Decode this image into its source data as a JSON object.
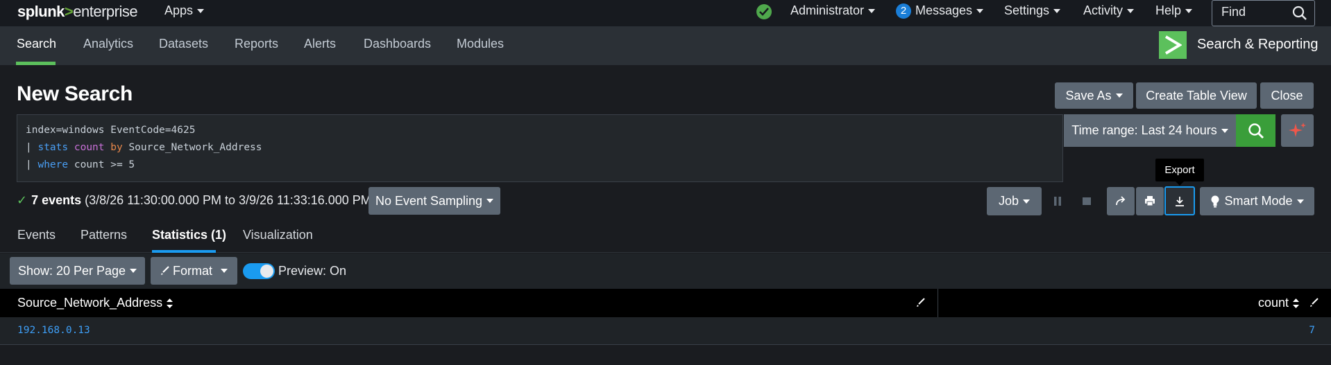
{
  "topbar": {
    "logo_bold": "splunk",
    "logo_gt": ">",
    "logo_rest": "enterprise",
    "apps_label": "Apps",
    "admin_label": "Administrator",
    "messages_count": "2",
    "messages_label": "Messages",
    "settings_label": "Settings",
    "activity_label": "Activity",
    "help_label": "Help",
    "find_label": "Find"
  },
  "appbar": {
    "tabs": [
      {
        "label": "Search"
      },
      {
        "label": "Analytics"
      },
      {
        "label": "Datasets"
      },
      {
        "label": "Reports"
      },
      {
        "label": "Alerts"
      },
      {
        "label": "Dashboards"
      },
      {
        "label": "Modules"
      }
    ],
    "app_name": "Search & Reporting"
  },
  "search": {
    "title": "New Search",
    "save_as": "Save As",
    "create_table_view": "Create Table View",
    "close": "Close",
    "query": {
      "line1": "index=windows EventCode=4625",
      "line2_pipe": "| ",
      "line2_cmd": "stats",
      "line2_func": "count",
      "line2_by": "by",
      "line2_field": "Source_Network_Address",
      "line3_pipe": "| ",
      "line3_cmd": "where",
      "line3_rest": "count >= 5"
    },
    "time_range": "Time range: Last 24 hours"
  },
  "status": {
    "check": "✓",
    "events": "7 events",
    "range": "(3/8/26 11:30:00.000 PM to 3/9/26 11:33:16.000 PM)",
    "sampling": "No Event Sampling",
    "job": "Job",
    "export_tooltip": "Export",
    "mode": "Smart Mode"
  },
  "result_tabs": [
    {
      "label": "Events"
    },
    {
      "label": "Patterns"
    },
    {
      "label": "Statistics (1)"
    },
    {
      "label": "Visualization"
    }
  ],
  "toolbar": {
    "per_page": "Show: 20 Per Page",
    "format": "Format",
    "preview": "Preview: On"
  },
  "table": {
    "columns": [
      "Source_Network_Address",
      "count"
    ],
    "rows": [
      [
        "192.168.0.13",
        "7"
      ]
    ]
  },
  "colors": {
    "accent_green": "#5cc05c",
    "accent_blue": "#1a9bf0",
    "button_gray": "#5c6773"
  }
}
